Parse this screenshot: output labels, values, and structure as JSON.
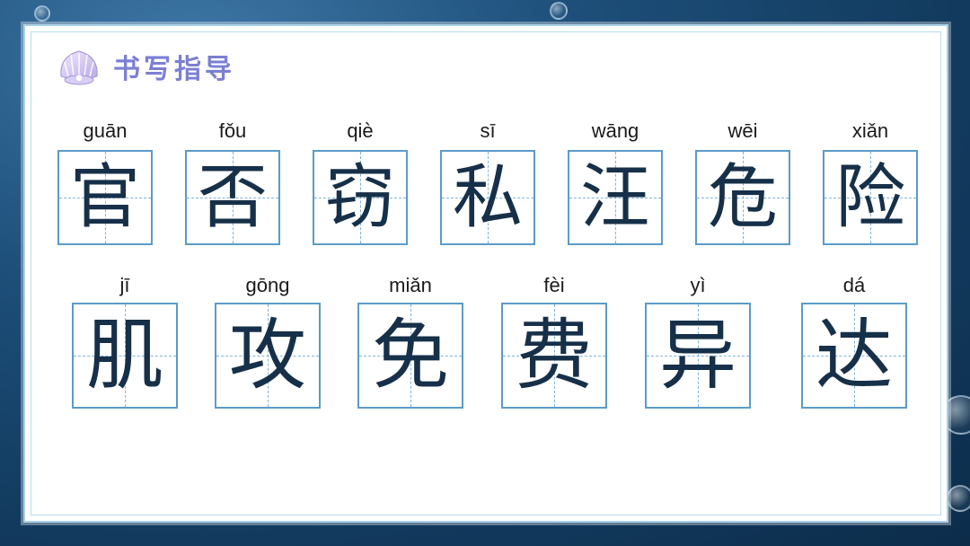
{
  "title": "书写指导",
  "icon": "shell-icon",
  "row1": [
    {
      "pinyin": "guān",
      "char": "官"
    },
    {
      "pinyin": "fǒu",
      "char": "否"
    },
    {
      "pinyin": "qiè",
      "char": "窃"
    },
    {
      "pinyin": "sī",
      "char": "私"
    },
    {
      "pinyin": "wāng",
      "char": "汪"
    },
    {
      "pinyin": "wēi",
      "char": "危"
    },
    {
      "pinyin": "xiǎn",
      "char": "险"
    }
  ],
  "row2": [
    {
      "pinyin": "jī",
      "char": "肌"
    },
    {
      "pinyin": "gōng",
      "char": "攻"
    },
    {
      "pinyin": "miǎn",
      "char": "免"
    },
    {
      "pinyin": "fèi",
      "char": "费"
    },
    {
      "pinyin": "yì",
      "char": "异"
    },
    {
      "pinyin": "dá",
      "char": "达"
    }
  ]
}
